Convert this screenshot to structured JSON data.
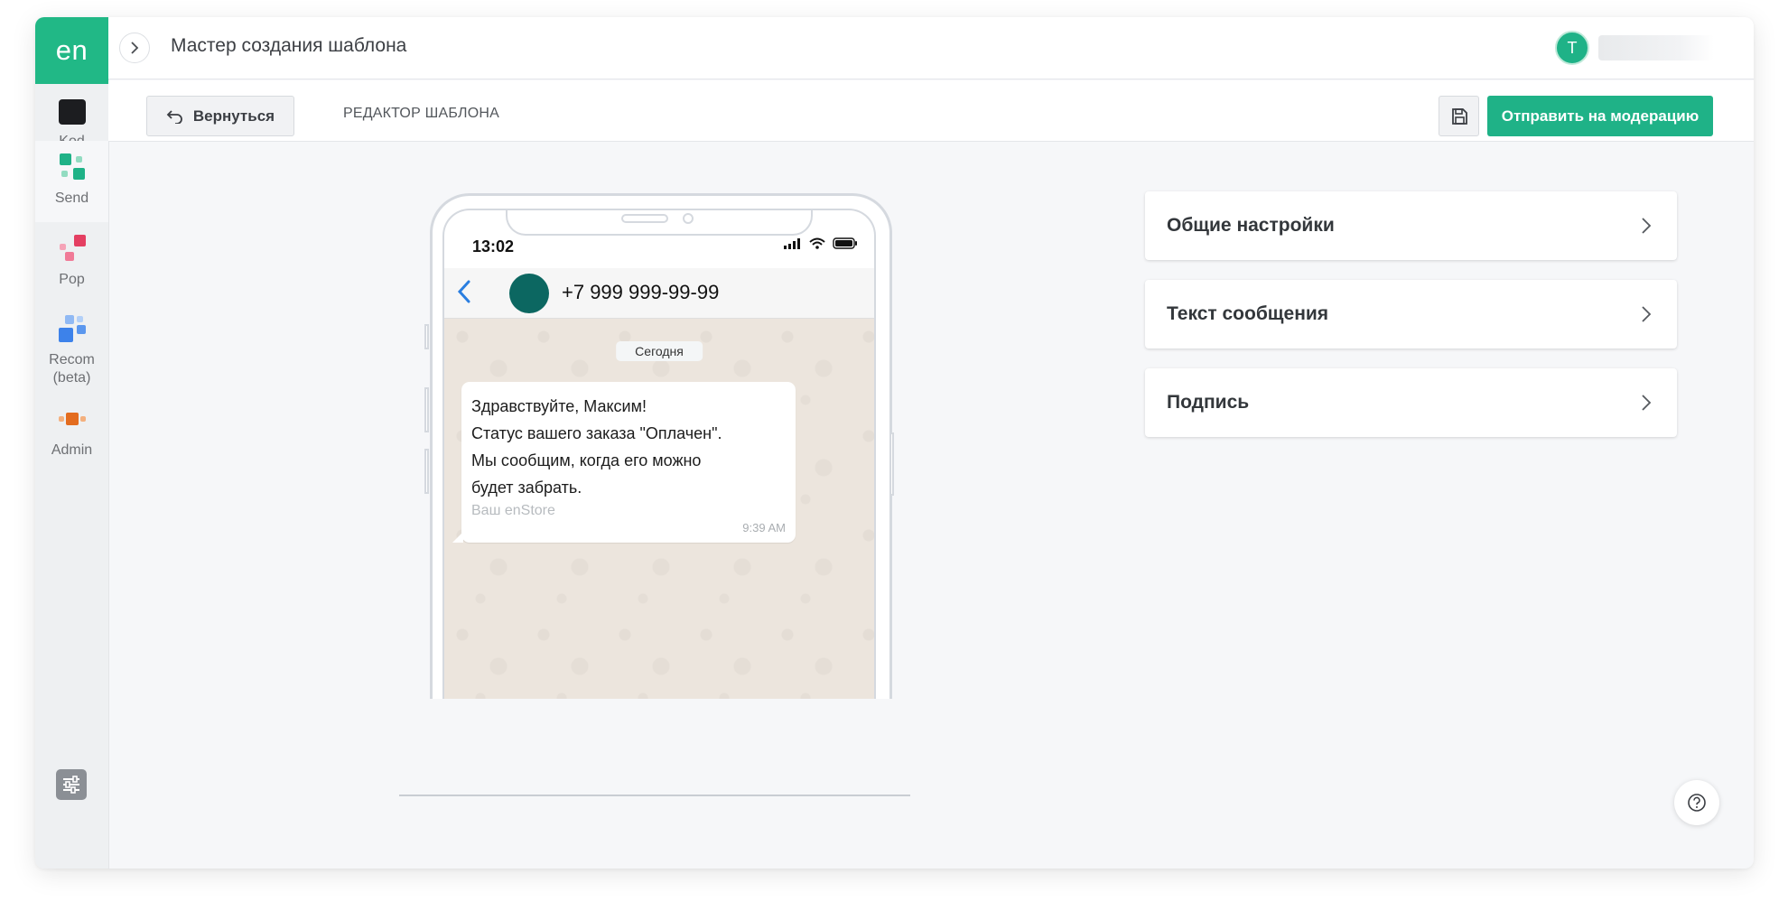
{
  "sidebar": {
    "logo": "en",
    "items": [
      {
        "label": "Kod"
      },
      {
        "label": "Send"
      },
      {
        "label": "Pop"
      },
      {
        "label": "Recom\n(beta)"
      },
      {
        "label": "Admin"
      }
    ]
  },
  "header": {
    "title": "Мастер создания шаблона",
    "avatar_initial": "T"
  },
  "toolbar": {
    "back_label": "Вернуться",
    "editor_label": "РЕДАКТОР ШАБЛОНА",
    "submit_label": "Отправить на модерацию"
  },
  "phone": {
    "status_time": "13:02",
    "contact": "+7 999 999-99-99",
    "date_label": "Сегодня",
    "message_lines": [
      "Здравствуйте, Максим!",
      "Статус вашего заказа \"Оплачен\".",
      "Мы сообщим, когда его можно",
      "будет забрать."
    ],
    "signature": "Ваш enStore",
    "message_time": "9:39 AM"
  },
  "accordion": [
    {
      "title": "Общие настройки"
    },
    {
      "title": "Текст сообщения"
    },
    {
      "title": "Подпись"
    }
  ],
  "colors": {
    "brand": "#21b886",
    "contact_avatar": "#0c6761"
  }
}
